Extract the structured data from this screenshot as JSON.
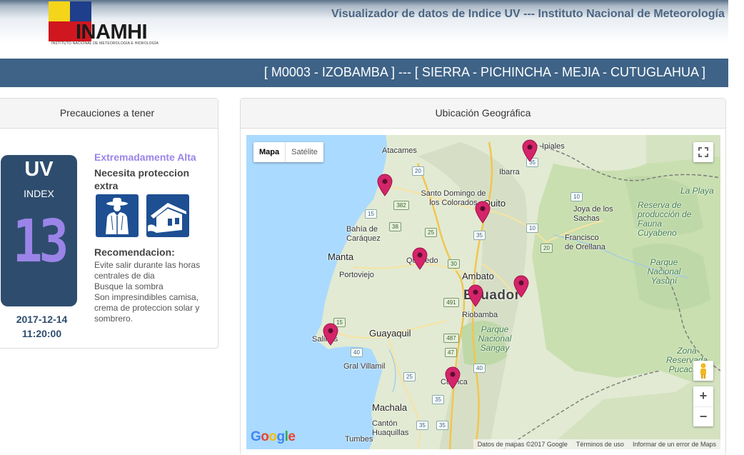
{
  "header": {
    "logo_text": "INAMHI",
    "logo_subtitle": "INSTITUTO NACIONAL DE METEOROLOGÍA E HIDROLOGÍA",
    "title": "Visualizador de datos de Indice UV --- Instituto Nacional de Meteorología"
  },
  "station": {
    "label": "[ M0003 - IZOBAMBA ] --- [ SIERRA - PICHINCHA - MEJIA - CUTUGLAHUA ]"
  },
  "precautions": {
    "title": "Precauciones a tener",
    "uv_label": "UV",
    "index_label": "INDEX",
    "uv_value": "13",
    "date": "2017-12-14",
    "time": "11:20:00",
    "level": "Extremadamente Alta",
    "need": "Necesita proteccion extra",
    "recommendation_title": "Recomendacion:",
    "recommendations": [
      "Evite salir durante las horas centrales de dia",
      "Busque la sombra",
      "Son impresindibles camisa, crema de proteccion solar y sombrero."
    ],
    "colors": {
      "card": "#2e4d6e",
      "value": "#9b84e8",
      "icon_bg": "#1d4f92"
    }
  },
  "map_panel": {
    "title": "Ubicación Geográfica",
    "map_type": {
      "map": "Mapa",
      "satellite": "Satélite"
    },
    "zoom": {
      "in": "+",
      "out": "−"
    },
    "google": "Google",
    "attribution": [
      "Datos de mapas ©2017 Google",
      "Términos de uso",
      "Informar de un error de Maps"
    ],
    "labels": {
      "atacames": "Atacames",
      "ipiales": "Ipiales",
      "ibarra": "Ibarra",
      "santo_domingo": "Santo Domingo de los Colorados",
      "quito": "Quito",
      "la_playa": "La Playa",
      "bahia": "Bahía de Caráquez",
      "joya": "Joya de los Sachas",
      "francisco": "Francisco de Orellana",
      "cuyabeno": "Reserva de producción de Fauna Cuyabeno",
      "manta": "Manta",
      "quevedo": "Quevedo",
      "portoviejo": "Portoviejo",
      "yasuni": "Parque Nacional Yasuní",
      "ambato": "Ambato",
      "ecuador": "Ecuador",
      "riobamba": "Riobamba",
      "guayaquil": "Guayaquil",
      "salinas": "Salinas",
      "sangay": "Parque Nacional Sangay",
      "villamil": "Gral Villamil",
      "pucacuro": "Zona Reservada Pucacuro",
      "cuenca": "Cuenca",
      "machala": "Machala",
      "canton": "Cantón Huaquillas",
      "tumbes": "Tumbes"
    },
    "shields": [
      "20",
      "35",
      "382",
      "15",
      "38",
      "25",
      "35",
      "10",
      "10",
      "20",
      "30",
      "15",
      "491",
      "487",
      "47",
      "40",
      "40",
      "35",
      "25",
      "35",
      "35"
    ]
  }
}
